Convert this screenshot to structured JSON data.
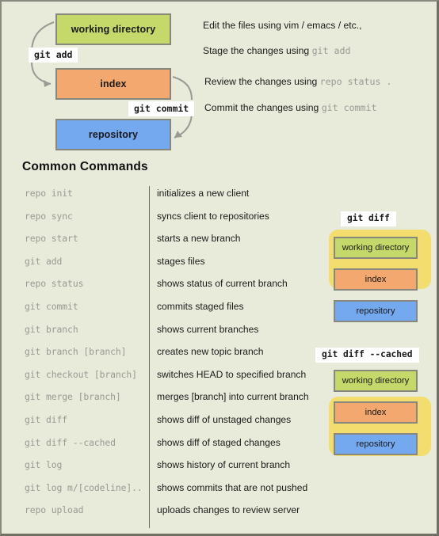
{
  "colors": {
    "background": "#e8eada",
    "working_directory": "#c4d96a",
    "index": "#f2a86e",
    "repository": "#74a9f0",
    "highlight": "#f2dd6e",
    "border": "#87877e",
    "mono_text": "#9a9a94"
  },
  "diagram": {
    "boxes": {
      "working_directory": "working directory",
      "index": "index",
      "repository": "repository"
    },
    "arrow_labels": {
      "git_add": "git add",
      "git_commit": "git commit"
    },
    "explanations": [
      {
        "id": "edit",
        "prefix": "Edit the files using vim / emacs / etc.,",
        "code": ""
      },
      {
        "id": "stage",
        "prefix": "Stage the changes using ",
        "code": "git add"
      },
      {
        "id": "review",
        "prefix": "Review  the changes using ",
        "code": "repo status  ."
      },
      {
        "id": "commit",
        "prefix": "Commit  the changes using ",
        "code": "git commit"
      }
    ]
  },
  "commands_section": {
    "heading": "Common Commands",
    "rows": [
      {
        "command": "repo init",
        "description": "initializes a new client"
      },
      {
        "command": "repo sync",
        "description": "syncs client to repositories"
      },
      {
        "command": "repo start",
        "description": "starts a new branch"
      },
      {
        "command": "git add",
        "description": "stages files"
      },
      {
        "command": "repo status",
        "description": "shows status of current branch"
      },
      {
        "command": "git commit",
        "description": "commits staged files"
      },
      {
        "command": "git branch",
        "description": "shows current branches"
      },
      {
        "command": "git branch [branch]",
        "description": "creates new topic branch"
      },
      {
        "command": "git checkout [branch]",
        "description": "switches HEAD to specified branch"
      },
      {
        "command": "git merge [branch]",
        "description": "merges [branch] into current branch"
      },
      {
        "command": "git diff",
        "description": "shows diff of unstaged changes"
      },
      {
        "command": "git diff --cached",
        "description": "shows diff of staged changes"
      },
      {
        "command": "git log",
        "description": "shows history of current branch"
      },
      {
        "command": "git log m/[codeline]..",
        "description": "shows commits that are not pushed"
      },
      {
        "command": "repo upload",
        "description": "uploads changes to review server"
      }
    ]
  },
  "callouts": [
    {
      "id": "git-diff",
      "title": "git diff",
      "boxes": {
        "working_directory": "working directory",
        "index": "index",
        "repository": "repository"
      },
      "highlighted": [
        "working directory",
        "index"
      ]
    },
    {
      "id": "git-diff-cached",
      "title": "git diff --cached",
      "boxes": {
        "working_directory": "working directory",
        "index": "index",
        "repository": "repository"
      },
      "highlighted": [
        "index",
        "repository"
      ]
    }
  ]
}
